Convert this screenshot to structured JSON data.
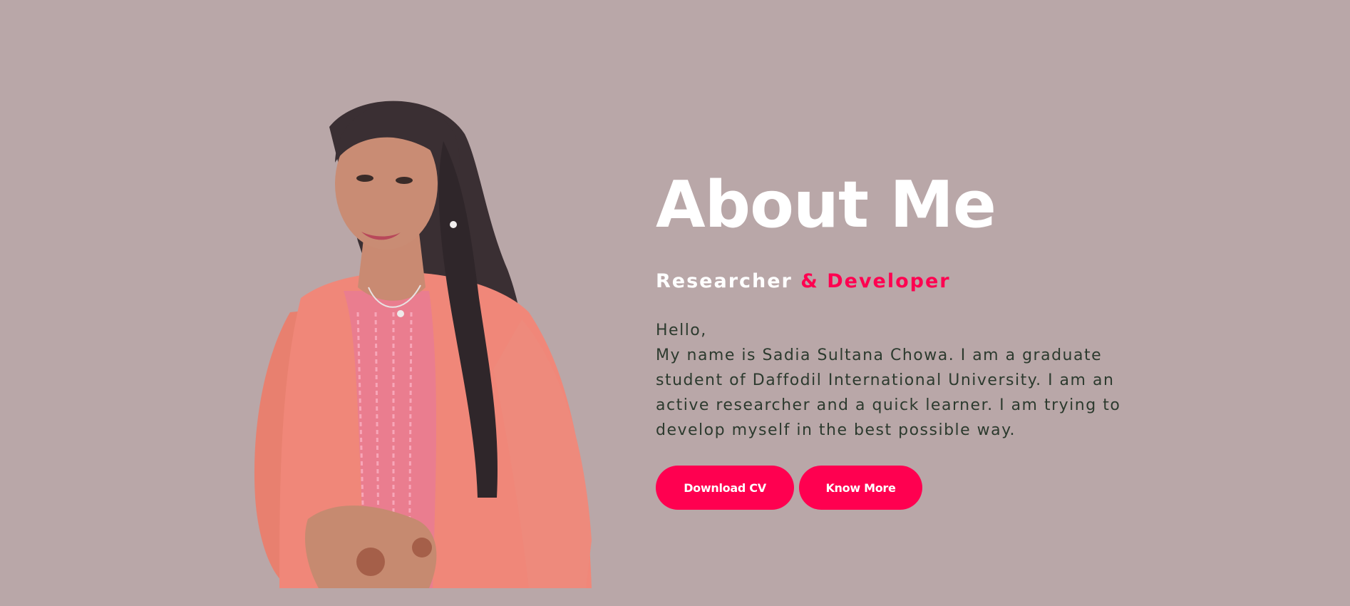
{
  "about": {
    "title": "About Me",
    "subtitle_part1": "Researcher ",
    "subtitle_part2": "& Developer",
    "greeting": "Hello,",
    "body": "My name is Sadia Sultana Chowa. I am a graduate student of Daffodil International University. I am an active researcher and a quick learner. I am trying to develop myself in the best possible way.",
    "buttons": {
      "download_cv": "Download CV",
      "know_more": "Know More"
    }
  },
  "colors": {
    "background": "#b9a7a8",
    "accent": "#ff0050",
    "heading": "#ffffff",
    "body_text": "#2c3a2e"
  }
}
